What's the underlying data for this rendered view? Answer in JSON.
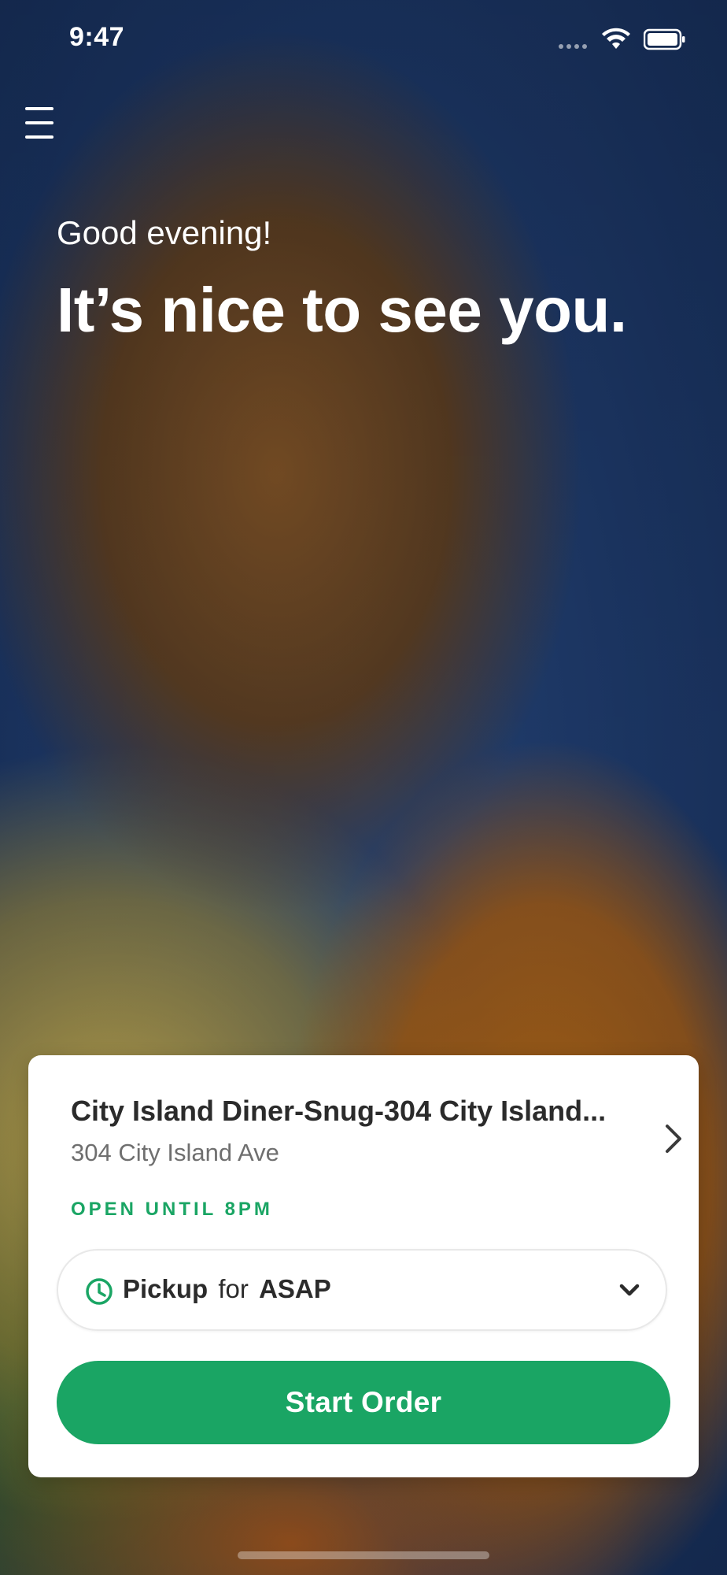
{
  "status_bar": {
    "time": "9:47"
  },
  "header": {
    "menu_icon": "hamburger-menu-icon"
  },
  "hero": {
    "greeting": "Good evening!",
    "headline": "It’s nice to see you."
  },
  "location_card": {
    "name": "City Island Diner-Snug-304 City Island...",
    "address": "304 City Island Ave",
    "open_status": "OPEN UNTIL 8PM",
    "pickup": {
      "mode": "Pickup",
      "connector": "for",
      "time": "ASAP"
    },
    "start_order_label": "Start Order"
  },
  "colors": {
    "accent_green": "#1aa564",
    "card_bg": "#ffffff",
    "text_dark": "#2b2b2b",
    "text_muted": "#6f6f6f"
  },
  "icons": {
    "menu": "hamburger-menu-icon",
    "location_chevron": "chevron-right-icon",
    "clock": "clock-icon",
    "dropdown": "chevron-down-icon",
    "wifi": "wifi-icon",
    "battery": "battery-icon"
  }
}
